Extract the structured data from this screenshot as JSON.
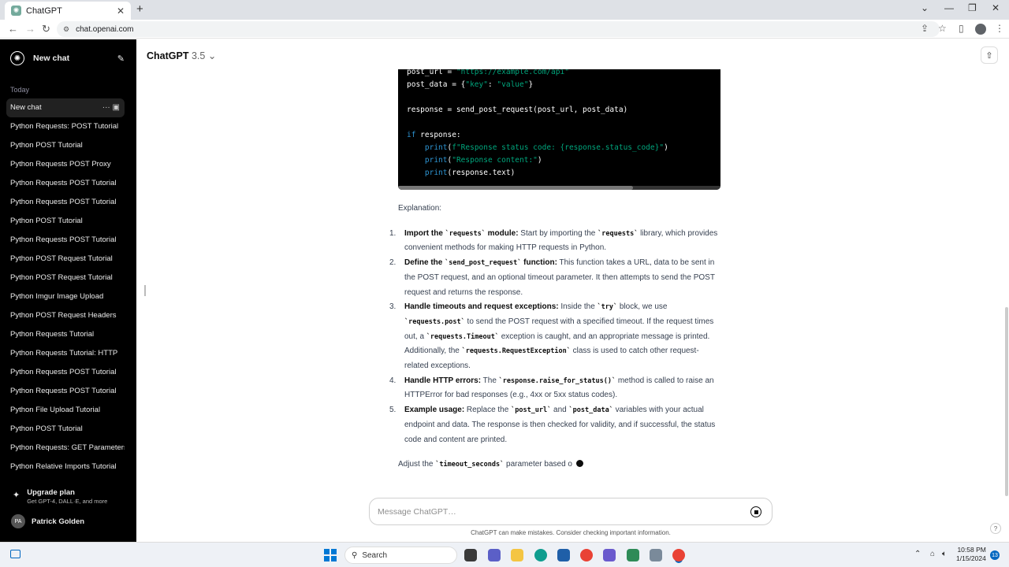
{
  "browser": {
    "tab_title": "ChatGPT",
    "url": "chat.openai.com"
  },
  "sidebar": {
    "new_chat": "New chat",
    "section_today": "Today",
    "items": [
      "New chat",
      "Python Requests: POST Tutorial",
      "Python POST Tutorial",
      "Python Requests POST Proxy",
      "Python Requests POST Tutorial",
      "Python Requests POST Tutorial",
      "Python POST Tutorial",
      "Python Requests POST Tutorial",
      "Python POST Request Tutorial",
      "Python POST Request Tutorial",
      "Python Imgur Image Upload",
      "Python POST Request Headers",
      "Python Requests Tutorial",
      "Python Requests Tutorial: HTTP",
      "Python Requests POST Tutorial",
      "Python Requests POST Tutorial",
      "Python File Upload Tutorial",
      "Python POST Tutorial",
      "Python Requests: GET Parameters",
      "Python Relative Imports Tutorial"
    ],
    "upgrade_title": "Upgrade plan",
    "upgrade_sub": "Get GPT-4, DALL·E, and more",
    "user_initials": "PA",
    "user_name": "Patrick Golden"
  },
  "header": {
    "model": "ChatGPT",
    "version": "3.5"
  },
  "code": {
    "lines": [
      [
        "post_url = ",
        "\"https://example.com/api\""
      ],
      [
        "post_data = {",
        "\"key\"",
        ": ",
        "\"value\"",
        "}"
      ],
      [
        "response = send_post_request(post_url, post_data)"
      ],
      [
        "if",
        " response:"
      ],
      [
        "    ",
        "print",
        "(",
        "f\"Response status code: {response.status_code}\"",
        ")"
      ],
      [
        "    ",
        "print",
        "(",
        "\"Response content:\"",
        ")"
      ],
      [
        "    ",
        "print",
        "(response.text)"
      ]
    ]
  },
  "answer": {
    "explanation": "Explanation:",
    "items": [
      {
        "n": "1.",
        "b1": "Import the ",
        "c1": "`requests`",
        "b2": " module:",
        "rest": [
          " Start by importing the ",
          {
            "code": "`requests`"
          },
          " library, which provides convenient methods for making HTTP requests in Python."
        ]
      },
      {
        "n": "2.",
        "b1": "Define the ",
        "c1": "`send_post_request`",
        "b2": " function:",
        "rest": [
          " This function takes a URL, data to be sent in the POST request, and an optional timeout parameter. It then attempts to send the POST request and returns the response."
        ]
      },
      {
        "n": "3.",
        "b1": "Handle timeouts and request exceptions:",
        "c1": "",
        "b2": "",
        "rest": [
          " Inside the ",
          {
            "code": "`try`"
          },
          " block, we use ",
          {
            "code": "`requests.post`"
          },
          " to send the POST request with a specified timeout. If the request times out, a ",
          {
            "code": "`requests.Timeout`"
          },
          " exception is caught, and an appropriate message is printed. Additionally, the ",
          {
            "code": "`requests.RequestException`"
          },
          " class is used to catch other request-related exceptions."
        ]
      },
      {
        "n": "4.",
        "b1": "Handle HTTP errors:",
        "c1": "",
        "b2": "",
        "rest": [
          " The ",
          {
            "code": "`response.raise_for_status()`"
          },
          " method is called to raise an HTTPError for bad responses (e.g., 4xx or 5xx status codes)."
        ]
      },
      {
        "n": "5.",
        "b1": "Example usage:",
        "c1": "",
        "b2": "",
        "rest": [
          " Replace the ",
          {
            "code": "`post_url`"
          },
          " and ",
          {
            "code": "`post_data`"
          },
          " variables with your actual endpoint and data. The response is then checked for validity, and if successful, the status code and content are printed."
        ]
      }
    ],
    "tail_pre": "Adjust the ",
    "tail_code": "`timeout_seconds`",
    "tail_post": " parameter based o"
  },
  "composer": {
    "placeholder": "Message ChatGPT…",
    "disclaimer": "ChatGPT can make mistakes. Consider checking important information."
  },
  "taskbar": {
    "search": "Search",
    "time": "10:58 PM",
    "date": "1/15/2024",
    "notifications": "13"
  }
}
